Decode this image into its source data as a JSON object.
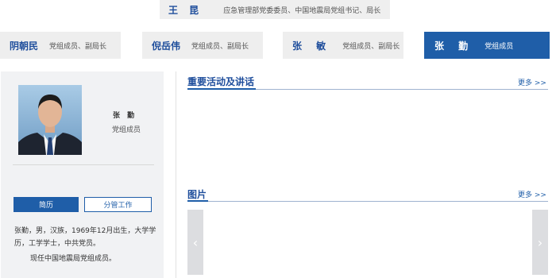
{
  "top_leader": {
    "name": "王 昆",
    "title": "应急管理部党委委员、中国地震局党组书记、局长"
  },
  "leaders": [
    {
      "name": "阴朝民",
      "title": "党组成员、副局长",
      "active": false
    },
    {
      "name": "倪岳伟",
      "title": "党组成员、副局长",
      "active": false
    },
    {
      "name": "张 敏",
      "title": "党组成员、副局长",
      "active": false
    },
    {
      "name": "张 勤",
      "title": "党组成员",
      "active": true
    }
  ],
  "profile": {
    "name": "张 勤",
    "title": "党组成员",
    "tabs": [
      "简历",
      "分管工作"
    ],
    "bio": "张勤，男，汉族，1969年12月出生，大学学历，工学学士，中共党员。",
    "current": "现任中国地震局党组成员。"
  },
  "sections": {
    "activities": {
      "title": "重要活动及讲话",
      "more": "更多 >>"
    },
    "pictures": {
      "title": "图片",
      "more": "更多 >>"
    }
  },
  "carousel": {
    "prev_icon": "‹",
    "next_icon": "›"
  },
  "colors": {
    "accent": "#1f5ea8",
    "heading": "#1f4e9c",
    "panel": "#f1f2f4"
  }
}
